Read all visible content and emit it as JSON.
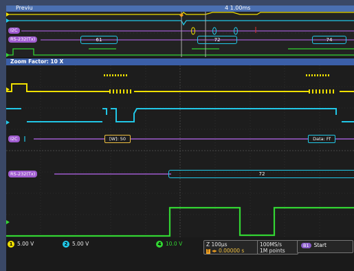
{
  "overview": {
    "title": "Previu",
    "timebase": "4 1.00ms",
    "i2c_label": "I2C",
    "rs232_label": "RS-232(Tx)",
    "packets": [
      "61",
      "72",
      "74"
    ]
  },
  "zoom": {
    "header": "Zoom Factor: 10 X",
    "i2c_label": "I2C",
    "i2c_write": "[W]: 50",
    "i2c_data": "Data: Ff",
    "rs232_label": "RS-232(Tx)",
    "rs232_packet": "72"
  },
  "channels": [
    {
      "num": "1",
      "volts": "5.00 V",
      "color": "#f0e000"
    },
    {
      "num": "2",
      "volts": "5.00 V",
      "color": "#21c8e8"
    },
    {
      "num": "4",
      "volts": "10.0 V",
      "color": "#33d633"
    }
  ],
  "readouts": {
    "horizontal": "Z 100µs",
    "trigger_pos": "0.00000 s",
    "sample_rate": "100MS/s",
    "record_length": "1M points",
    "start_button": "Start",
    "bus_badge": "B1"
  },
  "colors": {
    "ch1": "#f0e000",
    "ch2": "#21c8e8",
    "ch4": "#33d633",
    "bus": "#a05cd0",
    "frame": "#3a4866",
    "header": "#3b5fa8"
  }
}
